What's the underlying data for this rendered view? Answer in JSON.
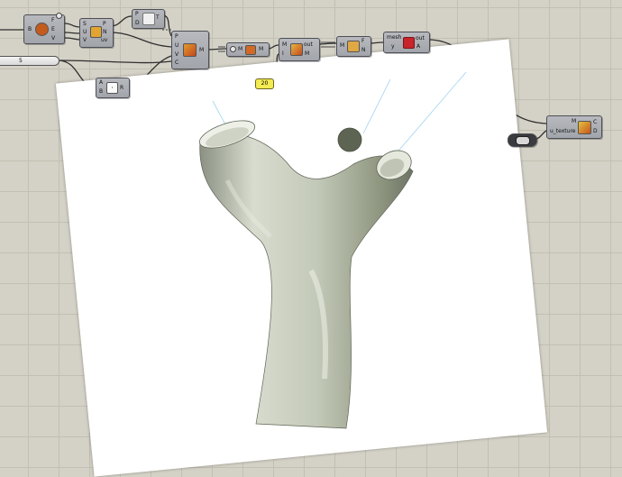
{
  "canvas": {
    "background": "#d4d1c6",
    "grid": true
  },
  "components": {
    "c1": {
      "left_in": "B",
      "outputs": [
        "F",
        "E",
        "V"
      ],
      "icon": "brep-edges-icon"
    },
    "c2": {
      "inputs": [
        "S",
        "U",
        "V"
      ],
      "outputs": [
        "P",
        "N",
        "uv"
      ],
      "icon": "evaluate-surface-icon"
    },
    "c3": {
      "inputs": [
        "P",
        "D"
      ],
      "output": "T",
      "icon": "palm-tree-icon"
    },
    "c4": {
      "inputs": [
        "A",
        "B"
      ],
      "output": "R",
      "icon": "division-icon"
    },
    "c5": {
      "inputs": [
        "P",
        "U",
        "V",
        "C"
      ],
      "output": "M",
      "icon": "mesh-surface-icon"
    },
    "c6": {
      "input": "M",
      "output": "M",
      "icon": "mesh-settings-icon"
    },
    "c7": {
      "inputs": [
        "M",
        "I"
      ],
      "outputs": [
        "out",
        "M"
      ],
      "icon": "mesh-smooth-icon"
    },
    "c8": {
      "input": "M",
      "outputs": [
        "F",
        "N"
      ],
      "icon": "mesh-faces-icon"
    },
    "c9": {
      "inputs": [
        "mesh",
        "y"
      ],
      "outputs": [
        "out",
        "A"
      ],
      "icon": "mesh-grasshopper-icon"
    },
    "c10": {
      "inputs": [
        "M",
        "u_texture"
      ],
      "outputs": [
        "C",
        "D"
      ],
      "icon": "texture-preview-icon"
    },
    "c11": {
      "icon": "colour-swatch-icon"
    }
  },
  "slider_value": "5",
  "panel_value": "20",
  "colors": {
    "node": "#a9acb2",
    "wire": "#2f2f2f",
    "panel": "#f4eb52",
    "model": "#c7ccbe"
  }
}
